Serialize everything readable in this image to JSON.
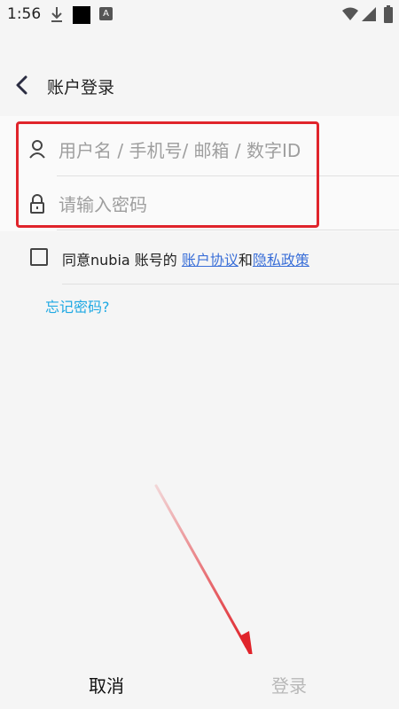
{
  "status_bar": {
    "time": "1:56",
    "icons": [
      "download-icon",
      "black-square-icon",
      "a-icon",
      "wifi-icon",
      "signal-icon",
      "battery-icon"
    ],
    "a_glyph": "A"
  },
  "header": {
    "title": "账户登录",
    "back_icon": "chevron-left-icon"
  },
  "form": {
    "username": {
      "placeholder": "用户名 / 手机号/ 邮箱 / 数字ID",
      "value": "",
      "icon": "user-icon"
    },
    "password": {
      "placeholder": "请输入密码",
      "value": "",
      "icon": "lock-icon"
    }
  },
  "agreement": {
    "checked": false,
    "prefix": "同意nubia 账号的 ",
    "link1": "账户协议",
    "middle": "和",
    "link2": "隐私政策"
  },
  "forgot_password": "忘记密码?",
  "footer": {
    "cancel_label": "取消",
    "login_label": "登录"
  },
  "colors": {
    "accent_link": "#3a6fd8",
    "forgot_link": "#1fa9e3",
    "highlight": "#e0242b",
    "disabled_text": "#b8b8b8"
  }
}
